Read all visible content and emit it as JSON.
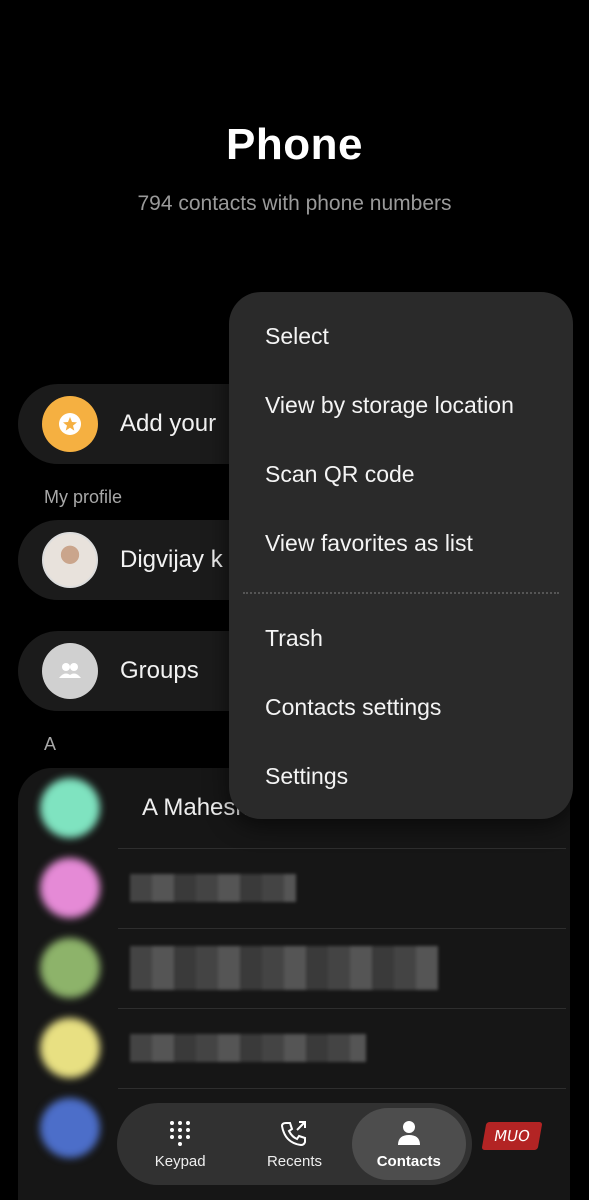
{
  "header": {
    "title": "Phone",
    "subtitle": "794 contacts with phone numbers"
  },
  "profile_card": {
    "label": "Add your"
  },
  "my_profile": {
    "section_label": "My profile",
    "name": "Digvijay k"
  },
  "groups": {
    "label": "Groups"
  },
  "contacts": {
    "section_letter": "A",
    "items": [
      {
        "name": "A Maheshv",
        "avatar_color": "#7fe3c0"
      },
      {
        "name": "",
        "avatar_color": "#e58ad6"
      },
      {
        "name": "",
        "avatar_color": "#8db36a"
      },
      {
        "name": "",
        "avatar_color": "#e8e082"
      },
      {
        "name": "",
        "avatar_color": "#4c6ec9"
      }
    ]
  },
  "menu": {
    "items": [
      "Select",
      "View by storage location",
      "Scan QR code",
      "View favorites as list",
      "Trash",
      "Contacts settings",
      "Settings"
    ]
  },
  "bottom_nav": {
    "keypad": "Keypad",
    "recents": "Recents",
    "contacts": "Contacts",
    "active": "contacts"
  },
  "watermark": "MUO",
  "colors": {
    "background": "#000000",
    "menu_bg": "#2a2a2a",
    "star_avatar": "#f5b041",
    "watermark_red": "#b32424"
  },
  "icons": [
    "star-icon",
    "groups-icon",
    "keypad-icon",
    "recents-icon",
    "contacts-icon"
  ]
}
